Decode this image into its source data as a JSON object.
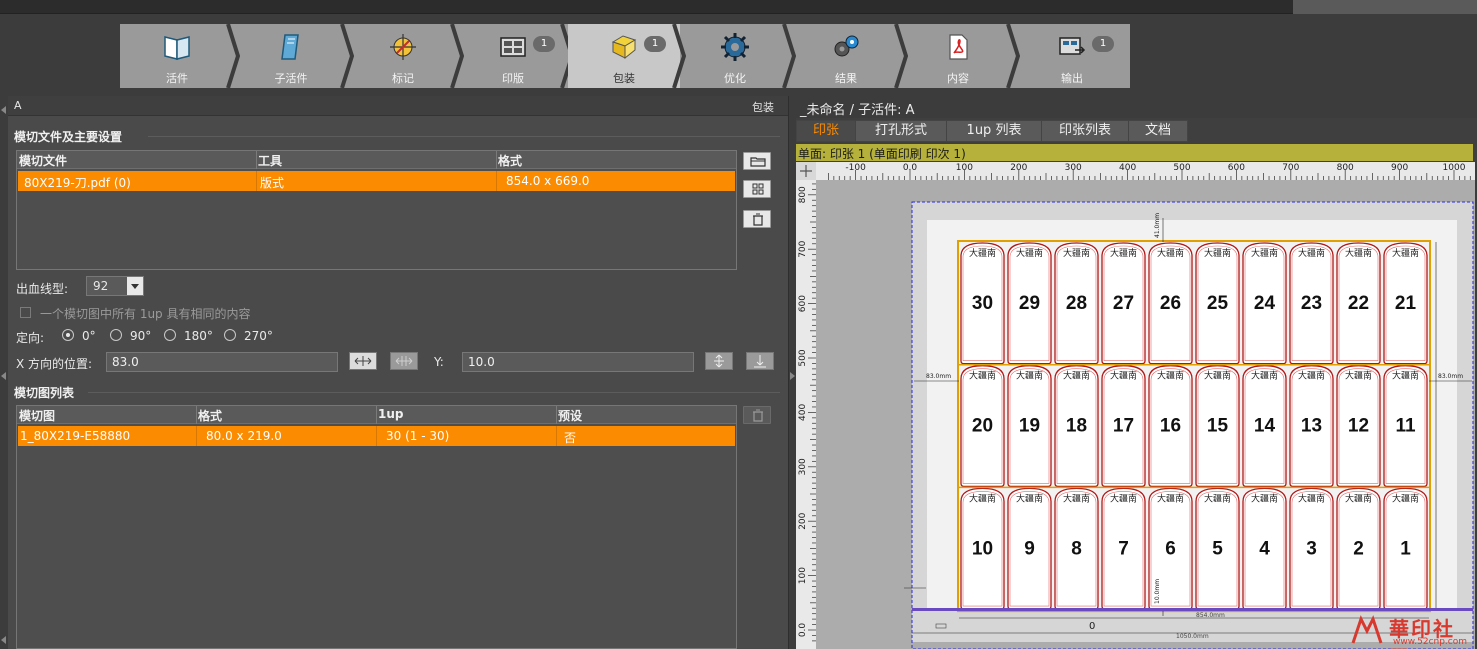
{
  "workflow_steps": [
    {
      "label": "活件",
      "icon": "book-icon",
      "badge": ""
    },
    {
      "label": "子活件",
      "icon": "document-icon",
      "badge": ""
    },
    {
      "label": "标记",
      "icon": "marks-icon",
      "badge": ""
    },
    {
      "label": "印版",
      "icon": "plate-icon",
      "badge": "1"
    },
    {
      "label": "包装",
      "icon": "package-icon",
      "badge": "1"
    },
    {
      "label": "优化",
      "icon": "gear-icon",
      "badge": ""
    },
    {
      "label": "结果",
      "icon": "result-gears-icon",
      "badge": ""
    },
    {
      "label": "内容",
      "icon": "pdf-icon",
      "badge": ""
    },
    {
      "label": "输出",
      "icon": "output-icon",
      "badge": "1"
    }
  ],
  "active_step": "包装",
  "left_panel": {
    "header_left": "A",
    "header_right": "包装",
    "section1_title": "模切文件及主要设置",
    "die_table": {
      "headers": [
        "模切文件",
        "工具",
        "格式"
      ],
      "rows": [
        [
          "80X219-刀.pdf (0)",
          "版式",
          "854.0 x 669.0"
        ]
      ]
    },
    "bleed_label": "出血线型:",
    "bleed_value": "92",
    "same_content_label": "一个模切图中所有 1up 具有相同的内容",
    "orientation_label": "定向:",
    "orientations": [
      "0°",
      "90°",
      "180°",
      "270°"
    ],
    "selected_orientation": "0°",
    "x_label": "X 方向的位置:",
    "x_value": "83.0",
    "y_label": "Y:",
    "y_value": "10.0",
    "section2_title": "模切图列表",
    "dieplan_table": {
      "headers": [
        "模切图",
        "格式",
        "1up",
        "预设"
      ],
      "rows": [
        [
          "1_80X219-E58880",
          "80.0 x 219.0",
          "30 (1 - 30)",
          "否"
        ]
      ]
    }
  },
  "right_panel": {
    "title": "_未命名 / 子活件: A",
    "tabs": [
      "印张",
      "打孔形式",
      "1up 列表",
      "印张列表",
      "文档"
    ],
    "active_tab": "印张",
    "status": "单面: 印张 1 (单面印刷 印次 1)",
    "hruler_ticks": [
      "-100",
      "0.0",
      "100",
      "200",
      "300",
      "400",
      "500",
      "600",
      "700",
      "800",
      "900",
      "1000"
    ],
    "vruler_ticks": [
      "800",
      "700",
      "600",
      "500",
      "400",
      "300",
      "200",
      "100",
      "0.0"
    ],
    "grid_rows": [
      [
        "30",
        "29",
        "28",
        "27",
        "26",
        "25",
        "24",
        "23",
        "22",
        "21"
      ],
      [
        "20",
        "19",
        "18",
        "17",
        "16",
        "15",
        "14",
        "13",
        "12",
        "11"
      ],
      [
        "10",
        "9",
        "8",
        "7",
        "6",
        "5",
        "4",
        "3",
        "2",
        "1"
      ]
    ],
    "cell_header_text": "大疆南",
    "dim_left": "83.0mm",
    "dim_right": "83.0mm",
    "dim_top": "41.0mm",
    "dim_bottom": "10.0mm",
    "dim_width": "854.0mm",
    "dim_sheet": "1050.0mm",
    "sheet_zero": "0"
  },
  "watermark": {
    "main": "華印社區",
    "sub": "www.52cnp.com"
  }
}
